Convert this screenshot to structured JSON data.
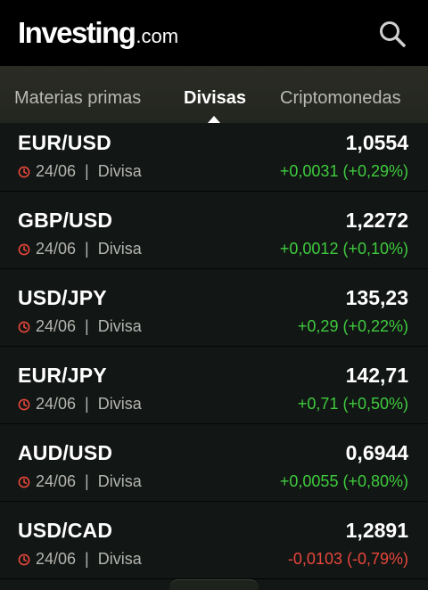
{
  "header": {
    "logo_main": "Investing",
    "logo_suffix": ".com",
    "search_icon": "search-icon"
  },
  "tabs": [
    {
      "label": "Materias primas",
      "active": false
    },
    {
      "label": "Divisas",
      "active": true
    },
    {
      "label": "Criptomonedas",
      "active": false
    }
  ],
  "rows": [
    {
      "pair": "EUR/USD",
      "price": "1,0554",
      "date": "24/06",
      "sep": "|",
      "type": "Divisa",
      "change": "+0,0031 (+0,29%)",
      "direction": "up"
    },
    {
      "pair": "GBP/USD",
      "price": "1,2272",
      "date": "24/06",
      "sep": "|",
      "type": "Divisa",
      "change": "+0,0012 (+0,10%)",
      "direction": "up"
    },
    {
      "pair": "USD/JPY",
      "price": "135,23",
      "date": "24/06",
      "sep": "|",
      "type": "Divisa",
      "change": "+0,29 (+0,22%)",
      "direction": "up"
    },
    {
      "pair": "EUR/JPY",
      "price": "142,71",
      "date": "24/06",
      "sep": "|",
      "type": "Divisa",
      "change": "+0,71 (+0,50%)",
      "direction": "up"
    },
    {
      "pair": "AUD/USD",
      "price": "0,6944",
      "date": "24/06",
      "sep": "|",
      "type": "Divisa",
      "change": "+0,0055 (+0,80%)",
      "direction": "up"
    },
    {
      "pair": "USD/CAD",
      "price": "1,2891",
      "date": "24/06",
      "sep": "|",
      "type": "Divisa",
      "change": "-0,0103 (-0,79%)",
      "direction": "down"
    }
  ],
  "colors": {
    "up": "#3fcb3f",
    "down": "#e8473c",
    "clock": "#e8473c"
  }
}
